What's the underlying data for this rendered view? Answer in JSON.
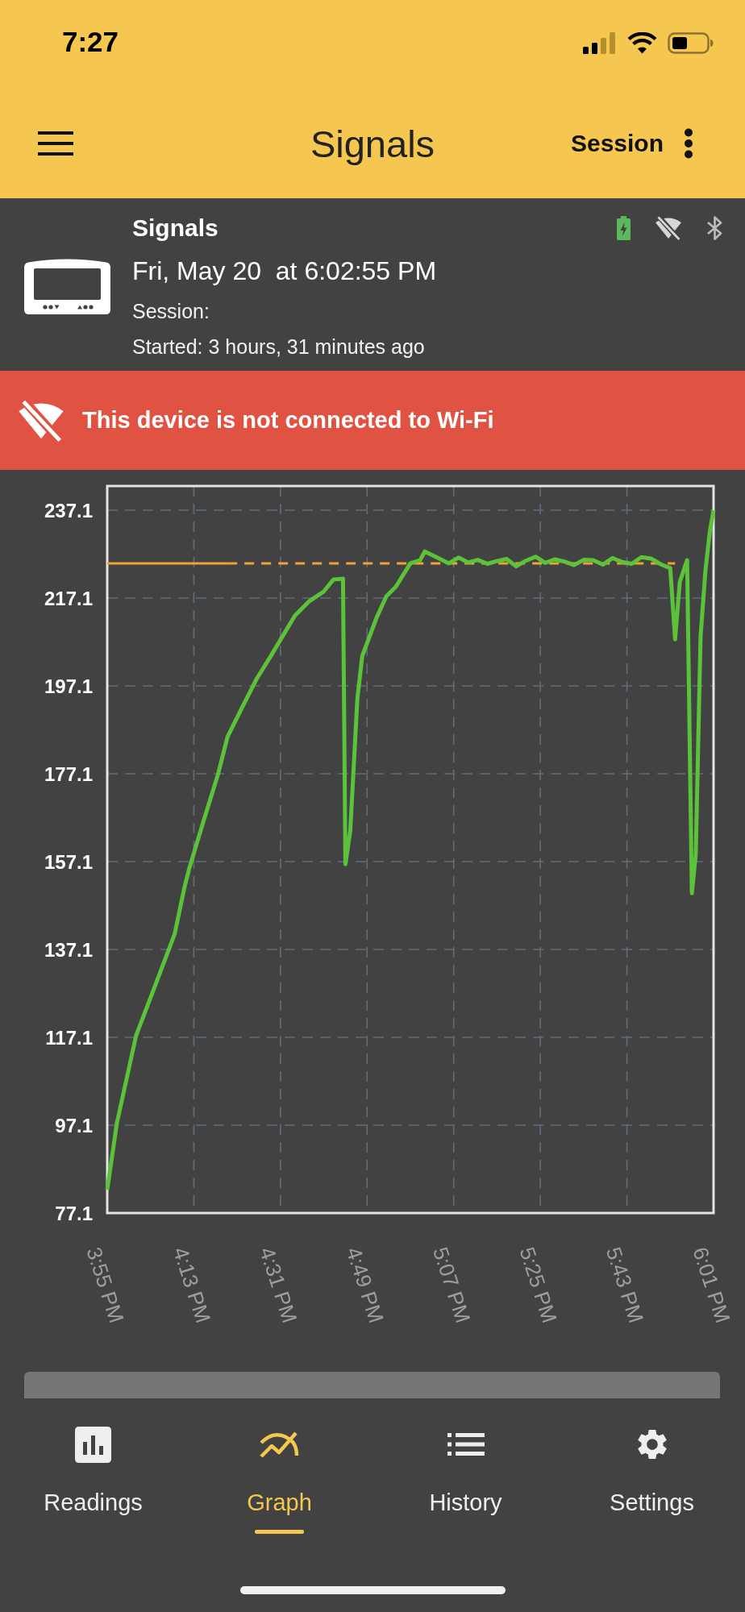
{
  "status_bar": {
    "time": "7:27"
  },
  "app_bar": {
    "title": "Signals",
    "action": "Session"
  },
  "device": {
    "name": "Signals",
    "date": "Fri, May 20  at 6:02:55 PM",
    "session": "Session:",
    "started": "Started: 3 hours, 31 minutes ago",
    "charging": true,
    "wifi_connected": false
  },
  "alert": {
    "text": "This device is not connected to Wi-Fi"
  },
  "graph": {
    "chart_data": {
      "type": "line",
      "grid": true,
      "x": [
        955,
        957,
        961,
        965,
        969,
        971,
        972,
        975,
        978,
        980,
        983,
        986,
        989,
        992,
        994,
        997,
        1000,
        1002,
        1004,
        1004.5,
        1005.5,
        1007,
        1008,
        1011,
        1013,
        1015,
        1018,
        1020,
        1021,
        1024,
        1026,
        1028,
        1030,
        1032,
        1034,
        1036,
        1038,
        1040,
        1042,
        1044,
        1046,
        1048,
        1050,
        1052,
        1054,
        1056,
        1058,
        1060,
        1062,
        1064,
        1066,
        1068,
        1070,
        1072,
        1073,
        1074,
        1075.5,
        1076.5,
        1077.3,
        1078.3,
        1079.3,
        1080.2,
        1081
      ],
      "series": [
        {
          "color": "#5cc23a",
          "line_style": "solid",
          "values": [
            82.4,
            97.5,
            117.5,
            129.0,
            140.6,
            151.0,
            155.4,
            166.3,
            176.9,
            185.5,
            192.1,
            198.6,
            203.9,
            209.4,
            213.1,
            216.4,
            218.6,
            221.3,
            221.5,
            156.5,
            164.1,
            194.3,
            203.9,
            212.7,
            217.5,
            219.7,
            225.0,
            225.7,
            227.7,
            226.1,
            225.0,
            226.3,
            225.2,
            225.8,
            224.9,
            225.5,
            226.0,
            224.3,
            225.6,
            226.5,
            225.1,
            225.9,
            225.4,
            224.6,
            225.8,
            225.7,
            224.7,
            226.2,
            225.3,
            224.9,
            226.4,
            226.1,
            224.8,
            223.9,
            207.7,
            220.8,
            225.7,
            149.9,
            158.6,
            208.3,
            223.3,
            232.0,
            237.1
          ]
        },
        {
          "color": "#f0a234",
          "line_style": "solid",
          "values": [
            225,
            225,
            225,
            225,
            225,
            225,
            225,
            225,
            225,
            225,
            null,
            null,
            null,
            null,
            null,
            null,
            null,
            null,
            null,
            null,
            null,
            null,
            null,
            null,
            null,
            null,
            null,
            null,
            null,
            null,
            null,
            null,
            null,
            null,
            null,
            null,
            null,
            null,
            null,
            null,
            null,
            null,
            null,
            null,
            null,
            null,
            null,
            null,
            null,
            null,
            null,
            null,
            null,
            null,
            null,
            null,
            null,
            null,
            null,
            null,
            null,
            null,
            null
          ]
        },
        {
          "color": "#f0a234",
          "line_style": "dashed",
          "values": [
            null,
            null,
            null,
            null,
            null,
            null,
            null,
            null,
            null,
            225,
            225,
            225,
            225,
            225,
            225,
            225,
            225,
            225,
            225,
            225,
            225,
            225,
            225,
            225,
            225,
            225,
            225,
            225,
            225,
            225,
            225,
            225,
            225,
            225,
            225,
            225,
            225,
            225,
            225,
            225,
            225,
            225,
            225,
            225,
            225,
            225,
            225,
            225,
            225,
            225,
            225,
            225,
            225,
            225,
            225,
            null,
            null,
            null,
            null,
            null,
            null,
            null,
            null
          ]
        }
      ],
      "xlim": [
        955,
        1081
      ],
      "ylim": [
        77.1,
        242.6
      ],
      "xticks": [
        {
          "value": 955,
          "label": "3:55 PM"
        },
        {
          "value": 973,
          "label": "4:13 PM"
        },
        {
          "value": 991,
          "label": "4:31 PM"
        },
        {
          "value": 1009,
          "label": "4:49 PM"
        },
        {
          "value": 1027,
          "label": "5:07 PM"
        },
        {
          "value": 1045,
          "label": "5:25 PM"
        },
        {
          "value": 1063,
          "label": "5:43 PM"
        },
        {
          "value": 1081,
          "label": "6:01 PM"
        }
      ],
      "yticks": [
        77.1,
        97.1,
        117.1,
        137.1,
        157.1,
        177.1,
        197.1,
        217.1,
        237.1
      ]
    }
  },
  "bottom_nav": {
    "items": [
      {
        "label": "Readings",
        "selected": false
      },
      {
        "label": "Graph",
        "selected": true
      },
      {
        "label": "History",
        "selected": false
      },
      {
        "label": "Settings",
        "selected": false
      }
    ]
  }
}
